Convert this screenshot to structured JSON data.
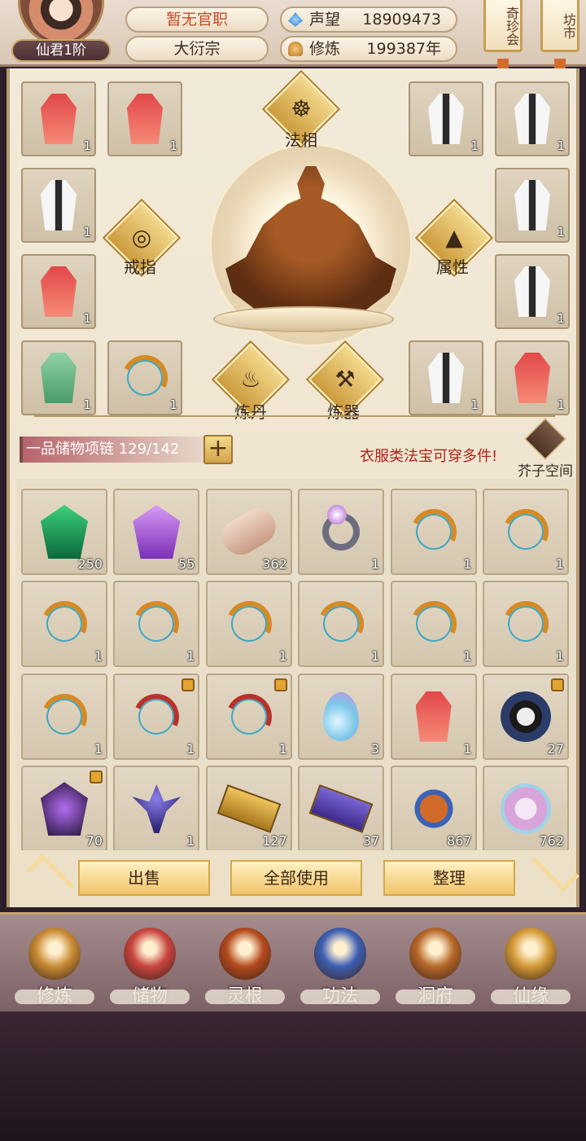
{
  "header": {
    "rank": "仙君1阶",
    "official_title": "暂无官职",
    "sect": "大衍宗",
    "prestige_label": "声望",
    "prestige_value": "18909473",
    "cultivation_label": "修炼",
    "cultivation_value": "199387年",
    "shop_buttons": [
      "奇珍会",
      "坊市"
    ]
  },
  "equip": {
    "left_slots": [
      {
        "item": "robe-red",
        "count": "1"
      },
      {
        "item": "robe-red",
        "count": "1"
      },
      {
        "item": "robe-white",
        "count": "1"
      },
      {
        "item": "robe-red",
        "count": "1"
      },
      {
        "item": "robe-green",
        "count": "1"
      },
      {
        "item": "bow",
        "count": "1"
      }
    ],
    "right_slots": [
      {
        "item": "robe-white",
        "count": "1"
      },
      {
        "item": "robe-white",
        "count": "1"
      },
      {
        "item": "robe-white",
        "count": "1"
      },
      {
        "item": "robe-white",
        "count": "1"
      },
      {
        "item": "robe-white",
        "count": "1"
      },
      {
        "item": "robe-red",
        "count": "1"
      }
    ],
    "actions": {
      "faxiang": "法相",
      "ring": "戒指",
      "attributes": "属性",
      "alchemy": "炼丹",
      "forging": "炼器"
    }
  },
  "storage": {
    "bag_name": "一品储物项链",
    "capacity": "129/142",
    "tip": "衣服类法宝可穿多件!",
    "space_label": "芥子空间"
  },
  "items": [
    {
      "icon": "gem-green",
      "count": "250",
      "locked": false
    },
    {
      "icon": "gem-purple",
      "count": "55",
      "locked": false
    },
    {
      "icon": "scroll",
      "count": "362",
      "locked": false
    },
    {
      "icon": "ring",
      "count": "1",
      "locked": false
    },
    {
      "icon": "bow",
      "count": "1",
      "locked": false
    },
    {
      "icon": "bow",
      "count": "1",
      "locked": false
    },
    {
      "icon": "bow",
      "count": "1",
      "locked": false
    },
    {
      "icon": "bow",
      "count": "1",
      "locked": false
    },
    {
      "icon": "bow",
      "count": "1",
      "locked": false
    },
    {
      "icon": "bow",
      "count": "1",
      "locked": false
    },
    {
      "icon": "bow",
      "count": "1",
      "locked": false
    },
    {
      "icon": "bow",
      "count": "1",
      "locked": false
    },
    {
      "icon": "bow",
      "count": "1",
      "locked": false
    },
    {
      "icon": "bow-red",
      "count": "1",
      "locked": true
    },
    {
      "icon": "bow-red",
      "count": "1",
      "locked": true
    },
    {
      "icon": "water-drop",
      "count": "3",
      "locked": false
    },
    {
      "icon": "robe-red",
      "count": "1",
      "locked": false
    },
    {
      "icon": "taiji-disc",
      "count": "27",
      "locked": true
    },
    {
      "icon": "gem-dark",
      "count": "70",
      "locked": true
    },
    {
      "icon": "spirit-plant",
      "count": "1",
      "locked": false
    },
    {
      "icon": "gold-ticket",
      "count": "127",
      "locked": false
    },
    {
      "icon": "violet-ticket",
      "count": "37",
      "locked": false
    },
    {
      "icon": "scorpion",
      "count": "867",
      "locked": false
    },
    {
      "icon": "flower",
      "count": "762",
      "locked": false
    }
  ],
  "buttons": {
    "sell": "出售",
    "use_all": "全部使用",
    "sort": "整理"
  },
  "nav": [
    {
      "label": "修炼",
      "icon": "cultivation-icon",
      "color": "#c98b34"
    },
    {
      "label": "储物",
      "icon": "bag-icon",
      "color": "#c9453f"
    },
    {
      "label": "灵根",
      "icon": "spirit-root-icon",
      "color": "#b44a1d"
    },
    {
      "label": "功法",
      "icon": "book-icon",
      "color": "#3d5fb4"
    },
    {
      "label": "洞府",
      "icon": "cave-icon",
      "color": "#b7682a"
    },
    {
      "label": "仙缘",
      "icon": "gourd-icon",
      "color": "#d49a37"
    }
  ]
}
